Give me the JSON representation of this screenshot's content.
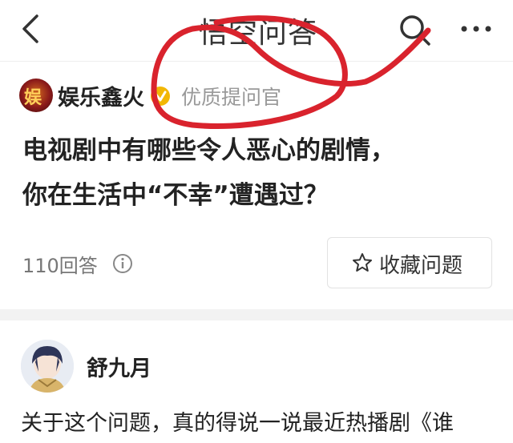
{
  "header": {
    "title": "悟空问答",
    "back_icon": "chevron-left-icon",
    "search_icon": "search-icon",
    "more_icon": "more-dots-icon"
  },
  "asker": {
    "avatar_text": "娱",
    "name": "娱乐鑫火",
    "badge_icon": "verified-v-badge",
    "badge_color": "#f2b705",
    "title": "优质提问官"
  },
  "question": {
    "line1": "电视剧中有哪些令人恶心的剧情，",
    "line2": "你在生活中“不幸”遭遇过？",
    "answer_count": "110回答",
    "collect_label": "收藏问题"
  },
  "answer": {
    "author": "舒九月",
    "snippet": "关于这个问题，真的得说一说最近热播剧《谁"
  },
  "annotation": {
    "color": "#d9232d"
  }
}
